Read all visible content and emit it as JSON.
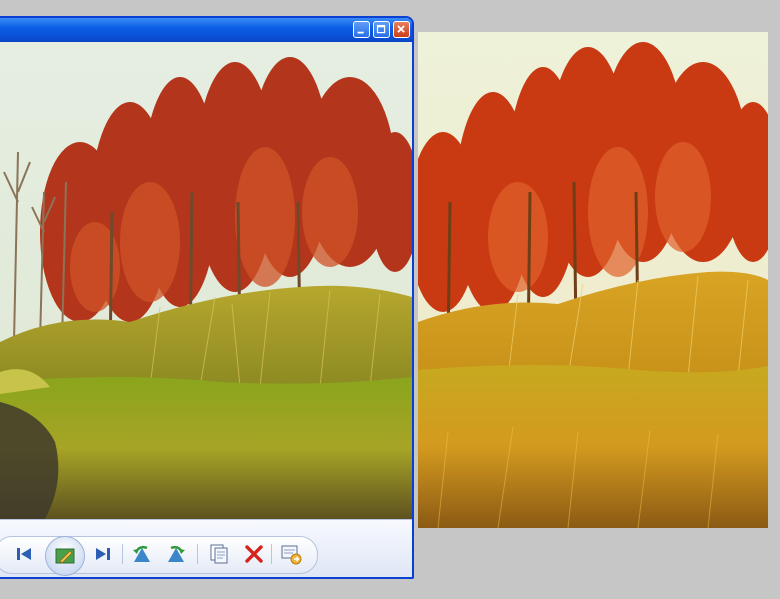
{
  "window": {
    "title_buttons": [
      {
        "name": "minimize",
        "icon": "minimize-icon"
      },
      {
        "name": "maximize",
        "icon": "maximize-icon"
      },
      {
        "name": "close",
        "icon": "close-icon"
      }
    ],
    "photo": {
      "subject": "",
      "palette": [
        "#e6efe2",
        "#b8321a",
        "#d98a1f",
        "#9aa51e",
        "#5d4a1c"
      ]
    },
    "toolbar": [
      {
        "name": "previous",
        "icon": "skip-previous-icon"
      },
      {
        "name": "edit",
        "icon": "edit-pencil-icon",
        "emphasized": true
      },
      {
        "name": "next",
        "icon": "skip-next-icon"
      },
      {
        "name": "rotate-left",
        "icon": "rotate-counterclockwise-icon"
      },
      {
        "name": "rotate-right",
        "icon": "rotate-clockwise-icon"
      },
      {
        "name": "copy",
        "icon": "copy-icon"
      },
      {
        "name": "delete",
        "icon": "delete-x-icon"
      },
      {
        "name": "open-with",
        "icon": "open-with-icon"
      }
    ]
  },
  "comparison": {
    "palette": [
      "#f0e7c6",
      "#c93a13",
      "#e29322",
      "#cfa11d",
      "#8b5a14"
    ]
  },
  "colors": {
    "titlebar": "#0b5fe6",
    "window_border": "#0a3fd3",
    "close_button": "#c93e1a",
    "desktop": "#c6c6c6"
  }
}
